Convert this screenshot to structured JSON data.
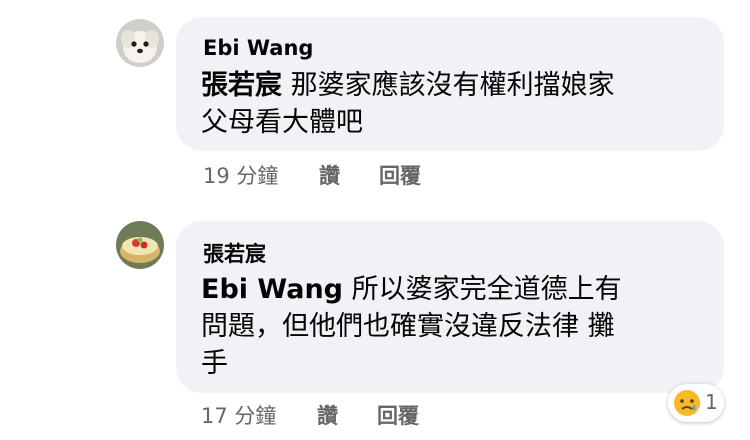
{
  "comments": [
    {
      "author": "Ebi Wang",
      "mention": "張若宸",
      "line1": " 那婆家應該沒有權利擋娘家",
      "line2": "父母看大體吧",
      "time": "19 分鐘",
      "like": "讚",
      "reply": "回覆"
    },
    {
      "author": "張若宸",
      "mention": "Ebi Wang",
      "line1": " 所以婆家完全道德上有",
      "line2": "問題，但他們也確實沒違反法律 攤",
      "line3": "手",
      "time": "17 分鐘",
      "like": "讚",
      "reply": "回覆",
      "reaction": {
        "icon": "sad-tear-emoji-icon",
        "count": "1"
      }
    }
  ],
  "colors": {
    "bubble": "#f0f2f5",
    "meta": "#65676b",
    "text": "#050505"
  }
}
